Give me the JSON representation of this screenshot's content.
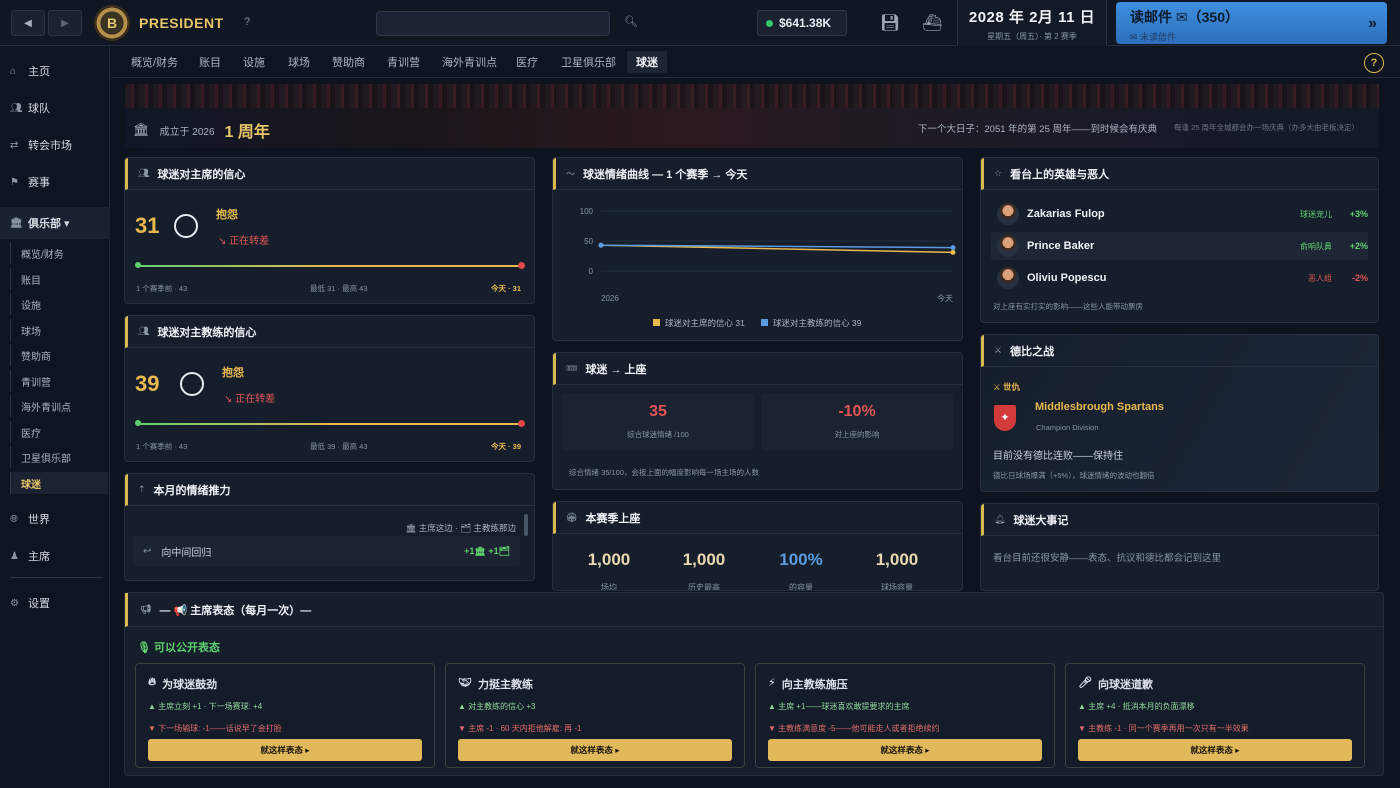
{
  "topbar": {
    "back_icon": "arrow-left-icon",
    "forward_icon": "arrow-right-icon",
    "brand": "PRESIDENT",
    "crest_letter": "B",
    "help": "?",
    "search_placeholder": "",
    "balance": "$641.38K",
    "date": "2028 年 2月 11 日",
    "date_sub": "星期五（周五）· 第 2 赛季",
    "mail_label": "读邮件 ✉（350）",
    "mail_sub": "✉ 未读信件",
    "mail_arrow": "»"
  },
  "sidebar": {
    "items": [
      {
        "label": "主页",
        "icon": "home-icon"
      },
      {
        "label": "球队",
        "icon": "team-icon"
      },
      {
        "label": "转会市场",
        "icon": "transfer-icon"
      },
      {
        "label": "赛事",
        "icon": "competition-icon"
      },
      {
        "label": "俱乐部 ▾",
        "icon": "club-icon"
      },
      {
        "label": "世界",
        "icon": "world-icon"
      },
      {
        "label": "主席",
        "icon": "chairman-icon"
      },
      {
        "label": "设置",
        "icon": "settings-icon"
      }
    ],
    "sub": [
      "概览/财务",
      "账目",
      "设施",
      "球场",
      "赞助商",
      "青训营",
      "海外青训点",
      "医疗",
      "卫星俱乐部",
      "球迷"
    ]
  },
  "tabs": [
    "概览/财务",
    "账目",
    "设施",
    "球场",
    "赞助商",
    "青训营",
    "海外青训点",
    "医疗",
    "卫星俱乐部",
    "球迷"
  ],
  "banner": {
    "founded": "成立于 2026",
    "years": "1 周年",
    "next": "下一个大日子：2051 年的第 25 周年——到时候会有庆典",
    "note": "每逢 25 周年全城都会办一场庆典（办多大由老板决定）"
  },
  "chair_conf": {
    "title": "球迷对主席的信心",
    "value": "31",
    "mood": "抱怨",
    "trend": "↘ 正在转差",
    "left": "1 个赛季前 · 43",
    "mid": "最低 31 · 最高 43",
    "right": "今天 · 31",
    "level": 0.31
  },
  "coach_conf": {
    "title": "球迷对主教练的信心",
    "value": "39",
    "mood": "抱怨",
    "trend": "↘ 正在转差",
    "left": "1 个赛季前 · 43",
    "mid": "最低 39 · 最高 43",
    "right": "今天 · 39",
    "level": 0.39
  },
  "momentum": {
    "title": "本月的情绪推力",
    "legend": "🏛 主席这边 · 🗂 主教练那边",
    "row_label": "向中间回归",
    "row_val": "+1🏛   +1🗂"
  },
  "mood_chart": {
    "title": "球迷情绪曲线 — 1 个赛季 → 今天",
    "legend_chair": "球迷对主席的信心 31",
    "legend_coach": "球迷对主教练的信心 39"
  },
  "chart_data": {
    "type": "line",
    "x": [
      "2026",
      "今天"
    ],
    "series": [
      {
        "name": "球迷对主席的信心 31",
        "values": [
          43,
          31
        ],
        "color": "#e7b94e"
      },
      {
        "name": "球迷对主教练的信心 39",
        "values": [
          43,
          39
        ],
        "color": "#5b9be0"
      }
    ],
    "yticks": [
      "0",
      "50",
      "100"
    ],
    "ylim": [
      0,
      100
    ]
  },
  "attendance": {
    "title": "球迷 → 上座",
    "v1": "35",
    "l1": "综合球迷情绪 /100",
    "v2": "-10%",
    "l2": "对上座的影响",
    "note": "综合情绪 35/100，会按上面的幅度影响每一场主场的人数"
  },
  "season": {
    "title": "本赛季上座",
    "cols": [
      {
        "val": "1,000",
        "lbl": "场均"
      },
      {
        "val": "1,000",
        "lbl": "历史最高"
      },
      {
        "val": "100%",
        "lbl": "的容量"
      },
      {
        "val": "1,000",
        "lbl": "球场容量"
      }
    ]
  },
  "heroes": {
    "title": "看台上的英雄与恶人",
    "rows": [
      {
        "name": "Zakarias Fulop",
        "tag": "球迷宠儿",
        "pct": "+3%",
        "color": "#5fd070"
      },
      {
        "name": "Prince Baker",
        "tag": "俞响队鼻",
        "pct": "+2%",
        "color": "#5fd070"
      },
      {
        "name": "Oliviu Popescu",
        "tag": "恶人组",
        "pct": "-2%",
        "color": "#e05555"
      }
    ],
    "note": "对上座有实打实的影响——这些人能带动票房"
  },
  "derby": {
    "title": "德比之战",
    "rival_tag": "⚔ 世仇",
    "club": "Middlesbrough Spartans",
    "division": "Champion Division",
    "status": "目前没有德比连败——保持住",
    "note": "德比日球场爆满（+5%），球迷情绪的波动也翻倍"
  },
  "events": {
    "title": "球迷大事记",
    "text": "看台目前还很安静——表态、抗议和德比都会记到这里"
  },
  "stance": {
    "title": "— 📢 主席表态（每月一次）—",
    "sub": "可以公开表态",
    "options": [
      {
        "title": "为球迷鼓劲",
        "icon": "flame-icon",
        "pos": "▲ 主席立刻 +1 · 下一场赛球: +4",
        "neg": "▼ 下一场输球: -1——话说早了会打脸",
        "btn": "就这样表态 ▸"
      },
      {
        "title": "力挺主教练",
        "icon": "handshake-icon",
        "pos": "▲ 对主教练的信心 +3",
        "neg": "▼ 主席 -1 · 60 天内拒他解雇: 再 -1",
        "btn": "就这样表态 ▸"
      },
      {
        "title": "向主教练施压",
        "icon": "lightning-icon",
        "pos": "▲ 主席 +1——球迷喜欢敢提要求的主席",
        "neg": "▼ 主教练满意度 -5——他可能走人或者拒绝续约",
        "btn": "就这样表态 ▸"
      },
      {
        "title": "向球迷道歉",
        "icon": "microphone-icon",
        "pos": "▲ 主席 +4 · 抵消本月的负面漂移",
        "neg": "▼ 主教练 -1 · 同一个赛季再用一次只有一半效果",
        "btn": "就这样表态 ▸"
      }
    ]
  }
}
